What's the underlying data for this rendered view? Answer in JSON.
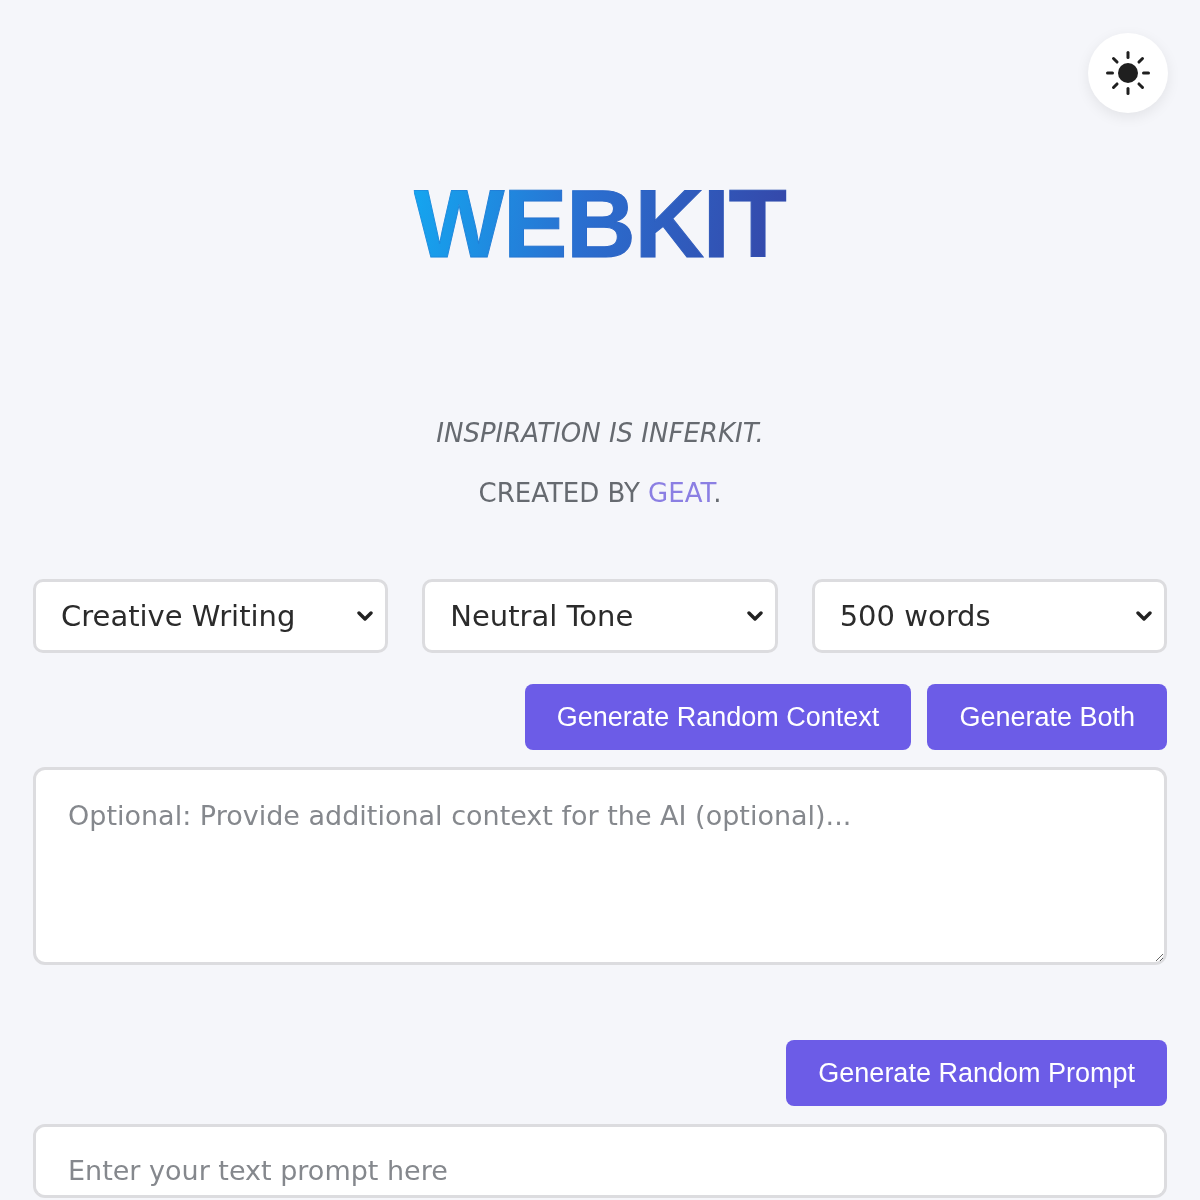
{
  "logo": {
    "text": "WEBKIT"
  },
  "tagline": "INSPIRATION IS INFERKIT.",
  "credit": {
    "prefix": "CREATED BY ",
    "link": "GEAT",
    "suffix": "."
  },
  "dropdowns": [
    {
      "value": "Creative Writing"
    },
    {
      "value": "Neutral Tone"
    },
    {
      "value": "500 words"
    }
  ],
  "context_actions": [
    "Generate Random Context",
    "Generate Both"
  ],
  "context_field": {
    "placeholder": "Optional: Provide additional context for the AI (optional)..."
  },
  "prompt_actions": [
    "Generate Random Prompt"
  ],
  "prompt_field": {
    "placeholder": "Enter your text prompt here"
  }
}
